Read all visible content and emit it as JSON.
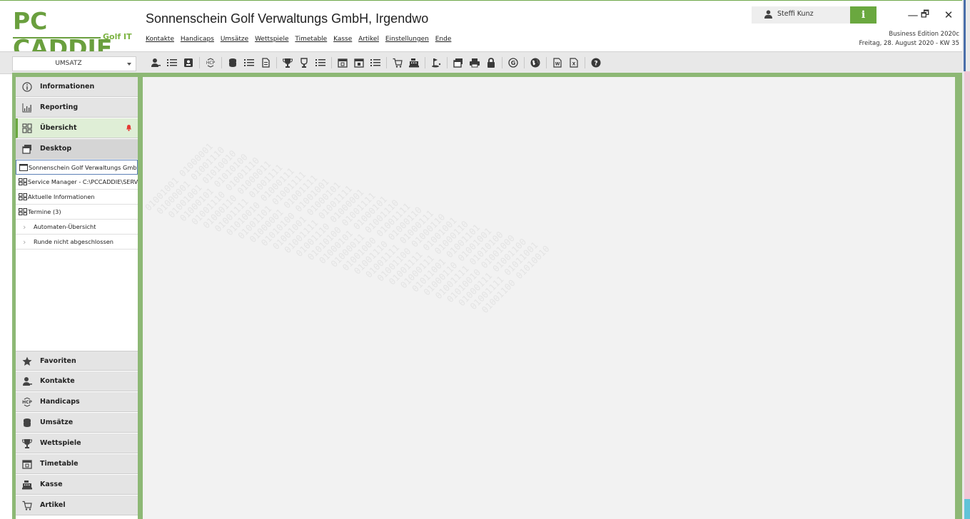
{
  "logo": {
    "main": "PC CADDIE",
    "sub": "Golf IT"
  },
  "title": "Sonnenschein Golf Verwaltungs GmbH, Irgendwo",
  "menu": [
    "Kontakte",
    "Handicaps",
    "Umsätze",
    "Wettspiele",
    "Timetable",
    "Kasse",
    "Artikel",
    "Einstellungen",
    "Ende"
  ],
  "user": {
    "name": "Steffi Kunz"
  },
  "info_label": "i",
  "window": {
    "minimize": "—",
    "restore": "🗗",
    "close": "✕"
  },
  "edition": {
    "line1": "Business Edition 2020c",
    "line2": "Freitag, 28. August 2020 - KW 35"
  },
  "module_select": {
    "value": "UMSATZ"
  },
  "toolbar_icons": [
    "contact-person-icon",
    "list-icon",
    "contact-card-icon",
    "hcp-icon",
    "coins-icon",
    "list-icon",
    "document-icon",
    "trophy-icon",
    "trophy-outline-icon",
    "list-icon",
    "calendar-icon",
    "calendar-icon",
    "list-icon",
    "cart-icon",
    "cash-register-icon",
    "golf-icon",
    "windows-icon",
    "print-icon",
    "lock-icon",
    "g-circle-icon",
    "globe-icon",
    "word-icon",
    "excel-icon",
    "help-icon"
  ],
  "sidebar": {
    "top": [
      {
        "label": "Informationen",
        "icon": "info-icon"
      },
      {
        "label": "Reporting",
        "icon": "chart-icon"
      },
      {
        "label": "Übersicht",
        "icon": "dashboard-icon"
      },
      {
        "label": "Desktop",
        "icon": "windows-icon"
      }
    ],
    "desktop_items": [
      {
        "label": "Sonnenschein Golf Verwaltungs GmbH",
        "icon": "window-icon"
      },
      {
        "label": "Service Manager - C:\\PCCADDIE\\SERVICE",
        "icon": "dashboard-icon"
      },
      {
        "label": "Aktuelle Informationen",
        "icon": "dashboard-icon"
      },
      {
        "label": "Termine (3)",
        "icon": "dashboard-icon"
      },
      {
        "label": "Automaten-Übersicht",
        "icon": "chevron-right-icon"
      },
      {
        "label": "Runde nicht abgeschlossen",
        "icon": "chevron-right-icon"
      }
    ],
    "bottom": [
      {
        "label": "Favoriten",
        "icon": "star-icon"
      },
      {
        "label": "Kontakte",
        "icon": "contact-person-icon"
      },
      {
        "label": "Handicaps",
        "icon": "hcp-icon"
      },
      {
        "label": "Umsätze",
        "icon": "coins-icon"
      },
      {
        "label": "Wettspiele",
        "icon": "trophy-icon"
      },
      {
        "label": "Timetable",
        "icon": "calendar-icon"
      },
      {
        "label": "Kasse",
        "icon": "cash-register-icon"
      },
      {
        "label": "Artikel",
        "icon": "cart-icon"
      }
    ]
  },
  "watermark": "01001001 01000001 01001001 01000101 01001110 01000110 01001111 01010010 01001101 01000001 01010100 01001001 01001111 01001110 01010100 01000101 01000011 01001000 01001110 01001111 01001100 01001111 01000111 01011001 01000110 01001111 01010010 01000111 01001111 01001100 01000110"
}
